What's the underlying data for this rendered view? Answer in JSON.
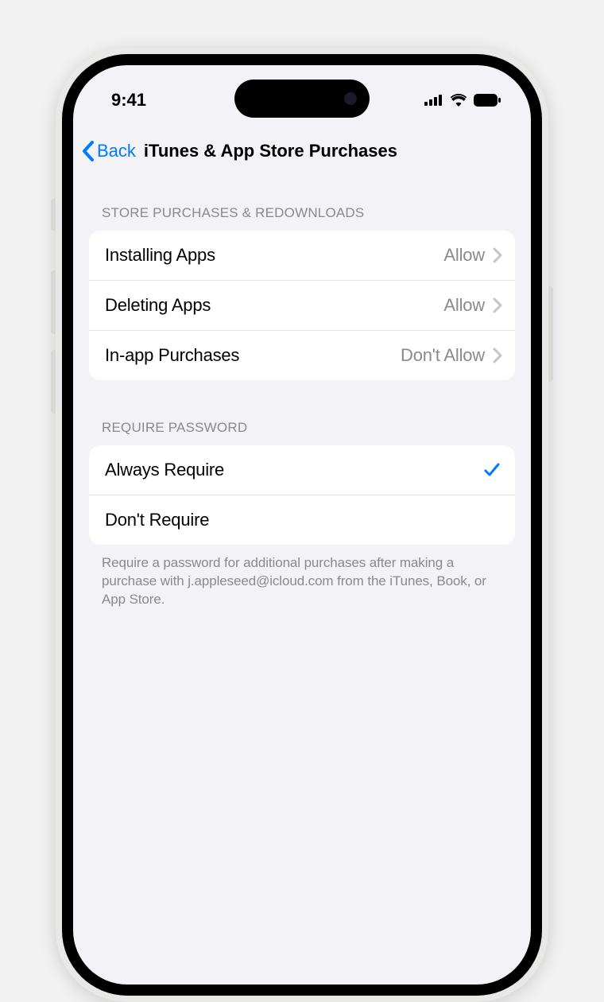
{
  "statusBar": {
    "time": "9:41"
  },
  "nav": {
    "backLabel": "Back",
    "title": "iTunes & App Store Purchases"
  },
  "sections": {
    "storePurchases": {
      "header": "STORE PURCHASES & REDOWNLOADS",
      "items": [
        {
          "label": "Installing Apps",
          "value": "Allow"
        },
        {
          "label": "Deleting Apps",
          "value": "Allow"
        },
        {
          "label": "In-app Purchases",
          "value": "Don't Allow"
        }
      ]
    },
    "requirePassword": {
      "header": "REQUIRE PASSWORD",
      "items": [
        {
          "label": "Always Require",
          "selected": true
        },
        {
          "label": "Don't Require",
          "selected": false
        }
      ],
      "footer": "Require a password for additional purchases after making a purchase with j.appleseed@icloud.com from the iTunes, Book, or App Store."
    }
  }
}
